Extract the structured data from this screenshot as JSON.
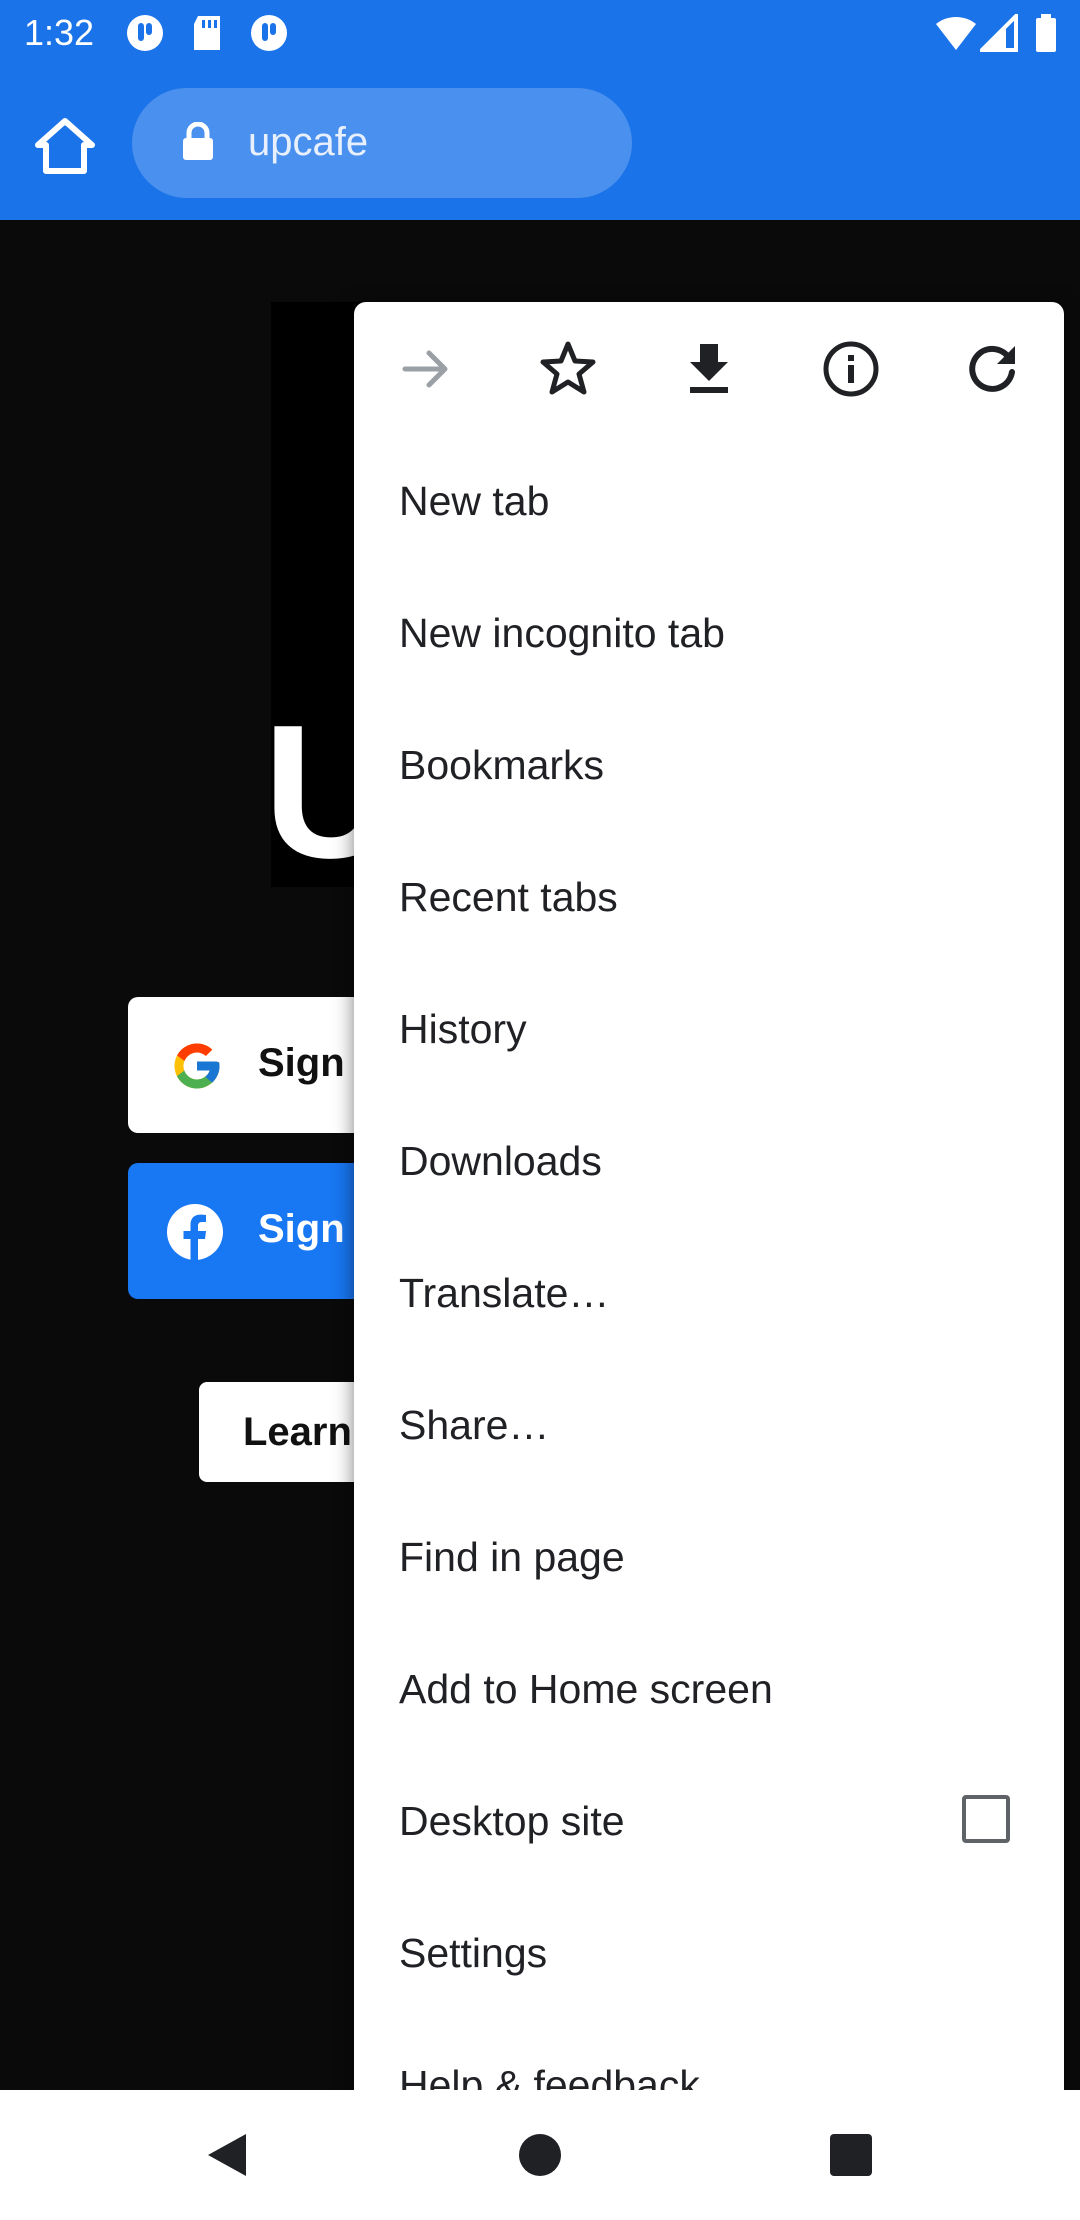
{
  "status": {
    "time": "1:32"
  },
  "toolbar": {
    "url": "upcafe"
  },
  "page": {
    "hero_letter": "U",
    "google_button": "Sign in",
    "facebook_button": "Sign in",
    "learn_button": "Learn"
  },
  "menu": {
    "items": [
      {
        "label": "New tab"
      },
      {
        "label": "New incognito tab"
      },
      {
        "label": "Bookmarks"
      },
      {
        "label": "Recent tabs"
      },
      {
        "label": "History"
      },
      {
        "label": "Downloads"
      },
      {
        "label": "Translate…"
      },
      {
        "label": "Share…"
      },
      {
        "label": "Find in page"
      },
      {
        "label": "Add to Home screen"
      },
      {
        "label": "Desktop site",
        "checked": false
      },
      {
        "label": "Settings"
      },
      {
        "label": "Help & feedback"
      }
    ]
  },
  "colors": {
    "accent": "#1a73e8",
    "facebook": "#1877f2",
    "page_bg": "#0a0a0a"
  },
  "icons": [
    "home-icon",
    "lock-icon",
    "forward-icon",
    "star-icon",
    "download-icon",
    "info-icon",
    "reload-icon",
    "back-nav-icon",
    "home-nav-icon",
    "recents-nav-icon"
  ]
}
